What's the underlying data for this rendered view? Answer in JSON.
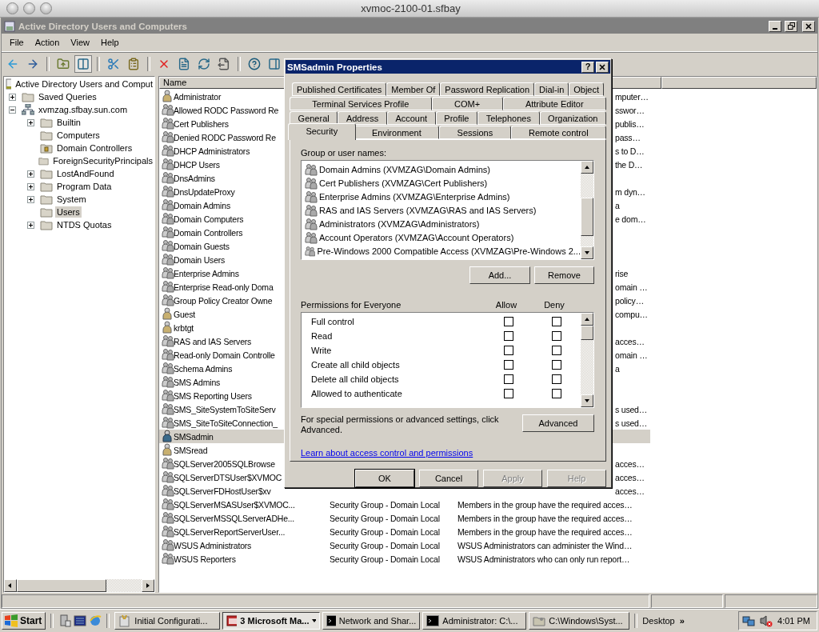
{
  "mac_window": {
    "title": "xvmoc-2100-01.sfbay"
  },
  "window": {
    "title": "Active Directory Users and Computers"
  },
  "menu": [
    "File",
    "Action",
    "View",
    "Help"
  ],
  "tree": {
    "root": "Active Directory Users and Comput",
    "items": [
      {
        "label": "Saved Queries",
        "kind": "folder",
        "expanded": false,
        "selected": false
      },
      {
        "label": "xvmzag.sfbay.sun.com",
        "kind": "domain",
        "expanded": true,
        "selected": false,
        "children": [
          {
            "label": "Builtin",
            "kind": "folder",
            "expanded": false,
            "selected": false
          },
          {
            "label": "Computers",
            "kind": "folder",
            "selected": false
          },
          {
            "label": "Domain Controllers",
            "kind": "ou",
            "selected": false
          },
          {
            "label": "ForeignSecurityPrincipals",
            "kind": "folder",
            "selected": false
          },
          {
            "label": "LostAndFound",
            "kind": "folder",
            "expanded": false,
            "selected": false
          },
          {
            "label": "Program Data",
            "kind": "folder",
            "expanded": false,
            "selected": false
          },
          {
            "label": "System",
            "kind": "folder",
            "expanded": false,
            "selected": false
          },
          {
            "label": "Users",
            "kind": "folder",
            "selected": true
          },
          {
            "label": "NTDS Quotas",
            "kind": "folder",
            "expanded": false,
            "selected": false
          }
        ]
      }
    ]
  },
  "list": {
    "columns": [
      "Name"
    ],
    "rows": [
      {
        "name": "Administrator",
        "kind": "user",
        "description": "mputer…",
        "selected": false
      },
      {
        "name": "Allowed RODC Password Re",
        "kind": "group",
        "description": "sswor…",
        "selected": false
      },
      {
        "name": "Cert Publishers",
        "kind": "group",
        "description": "publis…",
        "selected": false
      },
      {
        "name": "Denied RODC Password Re",
        "kind": "group",
        "description": "pass…",
        "selected": false
      },
      {
        "name": "DHCP Administrators",
        "kind": "group",
        "description": "s to D…",
        "selected": false
      },
      {
        "name": "DHCP Users",
        "kind": "group",
        "description": "the D…",
        "selected": false
      },
      {
        "name": "DnsAdmins",
        "kind": "group",
        "selected": false
      },
      {
        "name": "DnsUpdateProxy",
        "kind": "group",
        "description": "m dyn…",
        "selected": false
      },
      {
        "name": "Domain Admins",
        "kind": "group",
        "description": "a",
        "selected": false
      },
      {
        "name": "Domain Computers",
        "kind": "group",
        "description": "e dom…",
        "selected": false
      },
      {
        "name": "Domain Controllers",
        "kind": "group",
        "selected": false
      },
      {
        "name": "Domain Guests",
        "kind": "group",
        "selected": false
      },
      {
        "name": "Domain Users",
        "kind": "group",
        "selected": false
      },
      {
        "name": "Enterprise Admins",
        "kind": "group",
        "description": "rise",
        "selected": false
      },
      {
        "name": "Enterprise Read-only Doma",
        "kind": "group",
        "description": "omain …",
        "selected": false
      },
      {
        "name": "Group Policy Creator Owne",
        "kind": "group",
        "description": "policy…",
        "selected": false
      },
      {
        "name": "Guest",
        "kind": "user",
        "description": "compu…",
        "selected": false
      },
      {
        "name": "krbtgt",
        "kind": "user",
        "selected": false
      },
      {
        "name": "RAS and IAS Servers",
        "kind": "group",
        "description": "acces…",
        "selected": false
      },
      {
        "name": "Read-only Domain Controlle",
        "kind": "group",
        "description": "omain …",
        "selected": false
      },
      {
        "name": "Schema Admins",
        "kind": "group",
        "description": "a",
        "selected": false
      },
      {
        "name": "SMS Admins",
        "kind": "group",
        "selected": false
      },
      {
        "name": "SMS Reporting Users",
        "kind": "group",
        "selected": false
      },
      {
        "name": "SMS_SiteSystemToSiteServ",
        "kind": "group",
        "description": "s used…",
        "selected": false
      },
      {
        "name": "SMS_SiteToSiteConnection_",
        "kind": "group",
        "description": "s used…",
        "selected": false
      },
      {
        "name": "SMSadmin",
        "kind": "admin",
        "selected": true
      },
      {
        "name": "SMSread",
        "kind": "user",
        "selected": false
      },
      {
        "name": "SQLServer2005SQLBrowse",
        "kind": "group",
        "description": "acces…",
        "selected": false
      },
      {
        "name": "SQLServerDTSUser$XVMOC",
        "kind": "group",
        "description": "acces…",
        "selected": false
      },
      {
        "name": "SQLServerFDHostUser$xv",
        "kind": "group",
        "description": "acces…",
        "selected": false
      },
      {
        "name": "SQLServerMSASUser$XVMOC...",
        "kind": "group",
        "type": "Security Group - Domain Local",
        "description": "Members in the group have the required acces…",
        "selected": false
      },
      {
        "name": "SQLServerMSSQLServerADHe...",
        "kind": "group",
        "type": "Security Group - Domain Local",
        "description": "Members in the group have the required acces…",
        "selected": false
      },
      {
        "name": "SQLServerReportServerUser...",
        "kind": "group",
        "type": "Security Group - Domain Local",
        "description": "Members in the group have the required acces…",
        "selected": false
      },
      {
        "name": "WSUS Administrators",
        "kind": "group",
        "type": "Security Group - Domain Local",
        "description": "WSUS Administrators can administer the Wind…",
        "selected": false
      },
      {
        "name": "WSUS Reporters",
        "kind": "group",
        "type": "Security Group - Domain Local",
        "description": "WSUS Administrators who can only run report…",
        "selected": false
      }
    ]
  },
  "dialog": {
    "title": "SMSadmin Properties",
    "help_glyph": "?",
    "tab_rows": [
      [
        {
          "label": "Published Certificates",
          "selected": false
        },
        {
          "label": "Member Of",
          "selected": false
        },
        {
          "label": "Password Replication",
          "selected": false
        },
        {
          "label": "Dial-in",
          "selected": false
        },
        {
          "label": "Object",
          "selected": false
        }
      ],
      [
        {
          "label": "Terminal Services Profile",
          "selected": false
        },
        {
          "label": "COM+",
          "selected": false
        },
        {
          "label": "Attribute Editor",
          "selected": false
        }
      ],
      [
        {
          "label": "General",
          "selected": false
        },
        {
          "label": "Address",
          "selected": false
        },
        {
          "label": "Account",
          "selected": false
        },
        {
          "label": "Profile",
          "selected": false
        },
        {
          "label": "Telephones",
          "selected": false
        },
        {
          "label": "Organization",
          "selected": false
        }
      ],
      [
        {
          "label": "Security",
          "selected": true
        },
        {
          "label": "Environment",
          "selected": false
        },
        {
          "label": "Sessions",
          "selected": false
        },
        {
          "label": "Remote control",
          "selected": false
        }
      ]
    ],
    "group_label": "Group or user names:",
    "groups": [
      "Domain Admins (XVMZAG\\Domain Admins)",
      "Cert Publishers (XVMZAG\\Cert Publishers)",
      "Enterprise Admins (XVMZAG\\Enterprise Admins)",
      "RAS and IAS Servers (XVMZAG\\RAS and IAS Servers)",
      "Administrators (XVMZAG\\Administrators)",
      "Account Operators (XVMZAG\\Account Operators)",
      "Pre-Windows 2000 Compatible Access (XVMZAG\\Pre-Windows 2..."
    ],
    "add": "Add...",
    "remove": "Remove",
    "permissions_label": "Permissions for Everyone",
    "allow_label": "Allow",
    "deny_label": "Deny",
    "permissions": [
      {
        "name": "Full control",
        "allow": false,
        "deny": false
      },
      {
        "name": "Read",
        "allow": false,
        "deny": false
      },
      {
        "name": "Write",
        "allow": false,
        "deny": false
      },
      {
        "name": "Create all child objects",
        "allow": false,
        "deny": false
      },
      {
        "name": "Delete all child objects",
        "allow": false,
        "deny": false
      },
      {
        "name": "Allowed to authenticate",
        "allow": false,
        "deny": false
      }
    ],
    "advanced_note": "For special permissions or advanced settings, click Advanced.",
    "advanced": "Advanced",
    "link": "Learn about access control and permissions",
    "buttons": [
      {
        "label": "OK",
        "disabled": false
      },
      {
        "label": "Cancel",
        "disabled": false
      },
      {
        "label": "Apply",
        "disabled": true
      },
      {
        "label": "Help",
        "disabled": true
      }
    ]
  },
  "taskbar": {
    "start": "Start",
    "tasks": [
      {
        "label": "Initial Configurati...",
        "kind": "config",
        "selected": false
      },
      {
        "label": "3 Microsoft Ma...",
        "kind": "console",
        "selected": true
      },
      {
        "label": "Network and Shar...",
        "kind": "cmd",
        "selected": false
      },
      {
        "label": "Administrator: C:\\...",
        "kind": "cmd",
        "selected": false
      },
      {
        "label": "C:\\Windows\\Syst...",
        "kind": "folder",
        "selected": false
      }
    ],
    "desktop": "Desktop",
    "chevron": "»",
    "clock": "4:01 PM"
  }
}
